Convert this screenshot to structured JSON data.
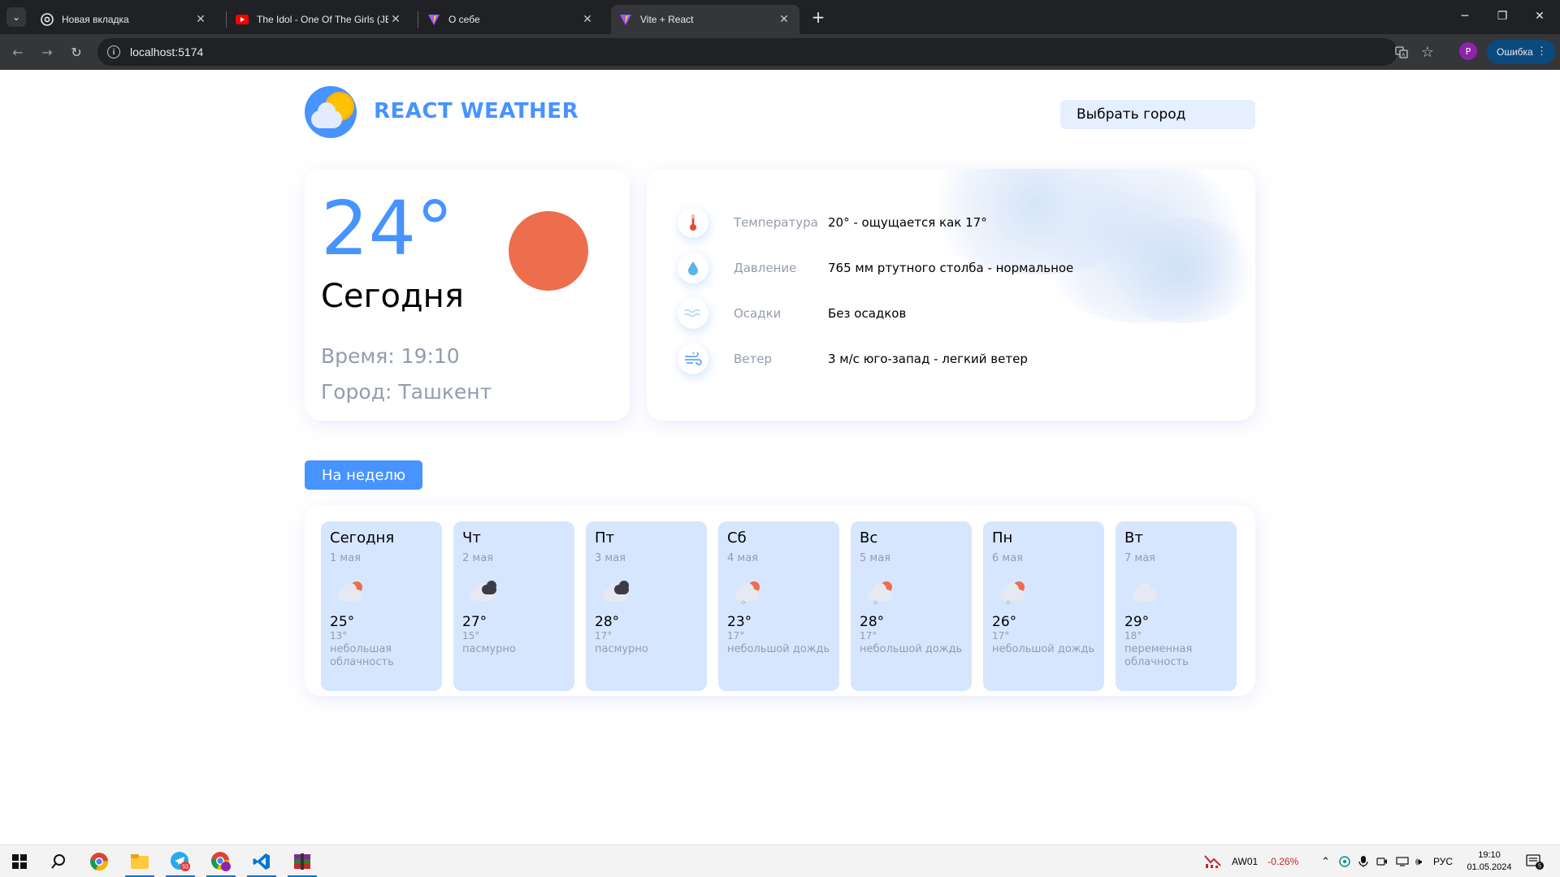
{
  "browser": {
    "tabs": [
      {
        "title": "Новая вкладка",
        "favicon": "chrome-icon",
        "active": false
      },
      {
        "title": "The Idol - One Of The Girls (JEN",
        "favicon": "youtube-icon",
        "active": false
      },
      {
        "title": "О себе",
        "favicon": "vite-icon",
        "active": false
      },
      {
        "title": "Vite + React",
        "favicon": "vite-icon",
        "active": true
      }
    ],
    "url": "localhost:5174",
    "profile_initial": "P",
    "error_label": "Ошибка"
  },
  "app": {
    "brand": "REACT WEATHER",
    "city_select": "Выбрать город",
    "today": {
      "temp": "24°",
      "label": "Сегодня",
      "time": "Время: 19:10",
      "city": "Город: Ташкент"
    },
    "details": [
      {
        "icon": "thermometer-icon",
        "label": "Температура",
        "value": "20° - ощущается как 17°"
      },
      {
        "icon": "droplet-icon",
        "label": "Давление",
        "value": "765 мм ртутного столба - нормальное"
      },
      {
        "icon": "precipitation-icon",
        "label": "Осадки",
        "value": "Без осадков"
      },
      {
        "icon": "wind-icon",
        "label": "Ветер",
        "value": "3 м/с юго-запад - легкий ветер"
      }
    ],
    "week_button": "На неделю",
    "days": [
      {
        "day": "Сегодня",
        "date": "1 мая",
        "max": "25°",
        "min": "13°",
        "desc": "небольшая облачность",
        "icon": "partly-cloudy-icon"
      },
      {
        "day": "Чт",
        "date": "2 мая",
        "max": "27°",
        "min": "15°",
        "desc": "пасмурно",
        "icon": "overcast-icon"
      },
      {
        "day": "Пт",
        "date": "3 мая",
        "max": "28°",
        "min": "17°",
        "desc": "пасмурно",
        "icon": "overcast-icon"
      },
      {
        "day": "Сб",
        "date": "4 мая",
        "max": "23°",
        "min": "17°",
        "desc": "небольшой дождь",
        "icon": "light-rain-icon"
      },
      {
        "day": "Вс",
        "date": "5 мая",
        "max": "28°",
        "min": "17°",
        "desc": "небольшой дождь",
        "icon": "light-rain-icon"
      },
      {
        "day": "Пн",
        "date": "6 мая",
        "max": "26°",
        "min": "17°",
        "desc": "небольшой дождь",
        "icon": "light-rain-icon"
      },
      {
        "day": "Вт",
        "date": "7 мая",
        "max": "29°",
        "min": "18°",
        "desc": "переменная облачность",
        "icon": "cloudy-icon"
      }
    ]
  },
  "taskbar": {
    "ticker_name": "AW01",
    "ticker_change": "-0.26%",
    "lang": "РУС",
    "time": "19:10",
    "date": "01.05.2024",
    "notifications": "5",
    "telegram_badge": "53"
  }
}
